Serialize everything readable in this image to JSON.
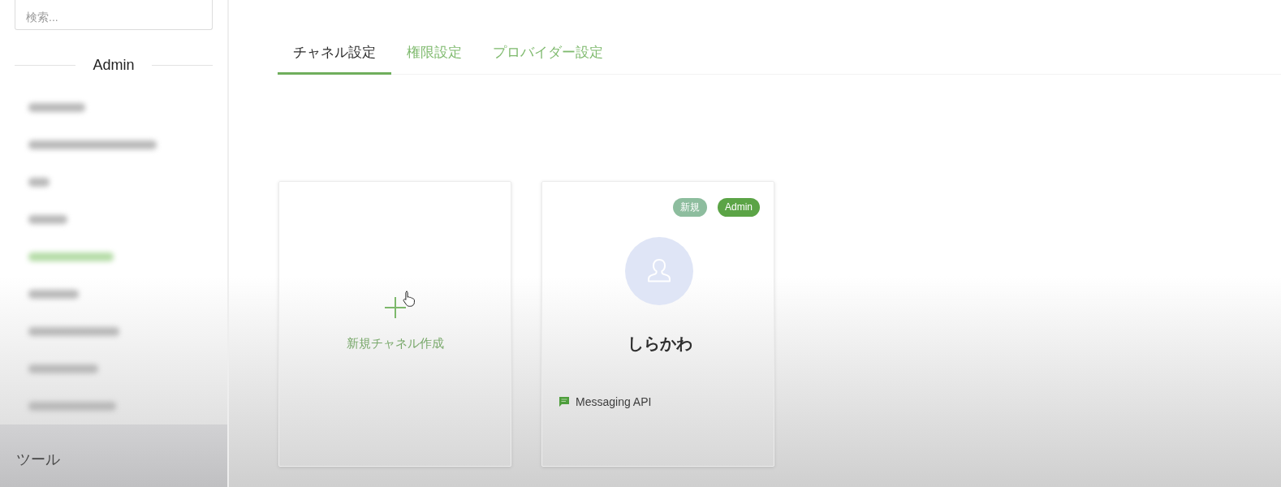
{
  "sidebar": {
    "search": {
      "placeholder": "検索..."
    },
    "section_title": "Admin",
    "blurred_items": [
      {
        "selected": false
      },
      {
        "selected": false
      },
      {
        "selected": false
      },
      {
        "selected": false
      },
      {
        "selected": true
      },
      {
        "selected": false
      },
      {
        "selected": false
      },
      {
        "selected": false
      },
      {
        "selected": false
      }
    ],
    "footer_label": "ツール"
  },
  "tabs": [
    {
      "label": "チャネル設定",
      "selected": true
    },
    {
      "label": "権限設定",
      "selected": false
    },
    {
      "label": "プロバイダー設定",
      "selected": false
    }
  ],
  "cards": [
    {
      "kind": "create",
      "label": "新規チャネル作成"
    },
    {
      "kind": "channel",
      "name": "しらかわ",
      "badges": [
        {
          "label": "新規",
          "color": "#8dbd9e"
        },
        {
          "label": "Admin",
          "color": "#5ba446"
        }
      ],
      "api": "Messaging API"
    }
  ]
}
